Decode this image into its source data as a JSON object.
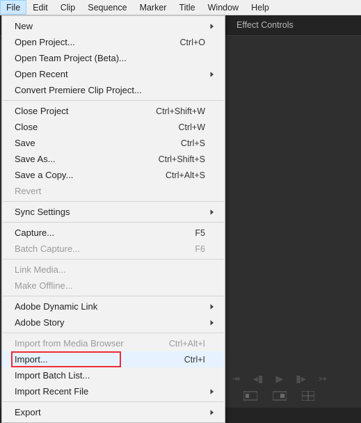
{
  "menubar": {
    "items": [
      {
        "label": "File",
        "active": true
      },
      {
        "label": "Edit",
        "active": false
      },
      {
        "label": "Clip",
        "active": false
      },
      {
        "label": "Sequence",
        "active": false
      },
      {
        "label": "Marker",
        "active": false
      },
      {
        "label": "Title",
        "active": false
      },
      {
        "label": "Window",
        "active": false
      },
      {
        "label": "Help",
        "active": false
      }
    ]
  },
  "panel": {
    "tabs": [
      {
        "label": "Effect Controls",
        "active": true
      }
    ]
  },
  "file_menu": {
    "groups": [
      [
        {
          "label": "New",
          "shortcut": "",
          "submenu": true
        },
        {
          "label": "Open Project...",
          "shortcut": "Ctrl+O"
        },
        {
          "label": "Open Team Project (Beta)...",
          "shortcut": ""
        },
        {
          "label": "Open Recent",
          "shortcut": "",
          "submenu": true
        },
        {
          "label": "Convert Premiere Clip Project...",
          "shortcut": ""
        }
      ],
      [
        {
          "label": "Close Project",
          "shortcut": "Ctrl+Shift+W"
        },
        {
          "label": "Close",
          "shortcut": "Ctrl+W"
        },
        {
          "label": "Save",
          "shortcut": "Ctrl+S"
        },
        {
          "label": "Save As...",
          "shortcut": "Ctrl+Shift+S"
        },
        {
          "label": "Save a Copy...",
          "shortcut": "Ctrl+Alt+S"
        },
        {
          "label": "Revert",
          "shortcut": "",
          "disabled": true
        }
      ],
      [
        {
          "label": "Sync Settings",
          "shortcut": "",
          "submenu": true
        }
      ],
      [
        {
          "label": "Capture...",
          "shortcut": "F5"
        },
        {
          "label": "Batch Capture...",
          "shortcut": "F6",
          "disabled": true
        }
      ],
      [
        {
          "label": "Link Media...",
          "shortcut": "",
          "disabled": true
        },
        {
          "label": "Make Offline...",
          "shortcut": "",
          "disabled": true
        }
      ],
      [
        {
          "label": "Adobe Dynamic Link",
          "shortcut": "",
          "submenu": true
        },
        {
          "label": "Adobe Story",
          "shortcut": "",
          "submenu": true
        }
      ],
      [
        {
          "label": "Import from Media Browser",
          "shortcut": "Ctrl+Alt+I",
          "disabled": true
        },
        {
          "label": "Import...",
          "shortcut": "Ctrl+I",
          "hover": true,
          "highlight": true
        },
        {
          "label": "Import Batch List...",
          "shortcut": ""
        },
        {
          "label": "Import Recent File",
          "shortcut": "",
          "submenu": true
        }
      ],
      [
        {
          "label": "Export",
          "shortcut": "",
          "submenu": true
        }
      ]
    ]
  }
}
